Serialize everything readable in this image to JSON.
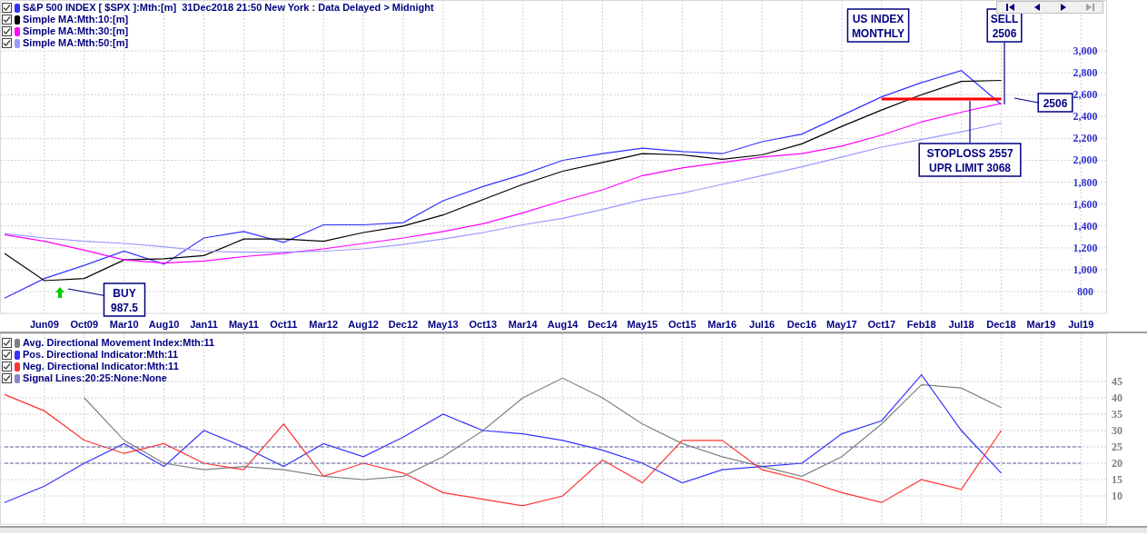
{
  "price_panel": {
    "legend": [
      {
        "label": "S&P 500 INDEX [ $SPX ]:Mth:[m]  31Dec2018 21:50 New York : Data Delayed > Midnight",
        "color": "#3333ff",
        "checked": true
      },
      {
        "label": "Simple MA:Mth:10:[m]",
        "color": "#000000",
        "checked": true
      },
      {
        "label": "Simple MA:Mth:30:[m]",
        "color": "#ff00ff",
        "checked": true
      },
      {
        "label": "Simple MA:Mth:50:[m]",
        "color": "#9999ff",
        "checked": true
      }
    ],
    "nav_buttons": [
      {
        "kind": "first",
        "disabled": false
      },
      {
        "kind": "prev",
        "disabled": false
      },
      {
        "kind": "next",
        "disabled": false
      },
      {
        "kind": "last",
        "disabled": true
      }
    ],
    "callouts": [
      {
        "lines": [
          "BUY",
          "987.5"
        ]
      },
      {
        "lines": [
          "US INDEX",
          "MONTHLY"
        ]
      },
      {
        "lines": [
          "SELL",
          "2506"
        ]
      },
      {
        "lines": [
          "2506"
        ]
      },
      {
        "lines": [
          "STOPLOSS 2557",
          "UPR LIMIT 3068"
        ]
      }
    ],
    "chart_data": {
      "type": "line",
      "categories": [
        null,
        "Jun09",
        "Oct09",
        "Mar10",
        "Aug10",
        "Jan11",
        "May11",
        "Oct11",
        "Mar12",
        "Aug12",
        "Dec12",
        "May13",
        "Oct13",
        "Mar14",
        "Aug14",
        "Dec14",
        "May15",
        "Oct15",
        "Mar16",
        "Jul16",
        "Dec16",
        "May17",
        "Oct17",
        "Feb18",
        "Jul18",
        "Dec18",
        "Mar19",
        "Jul19"
      ],
      "ylim": [
        601,
        3465
      ],
      "yticks": [
        {
          "value": 800,
          "label": "800"
        },
        {
          "value": 1000,
          "label": "1,000"
        },
        {
          "value": 1200,
          "label": "1,200"
        },
        {
          "value": 1400,
          "label": "1,400"
        },
        {
          "value": 1600,
          "label": "1,600"
        },
        {
          "value": 1800,
          "label": "1,800"
        },
        {
          "value": 2000,
          "label": "2,000"
        },
        {
          "value": 2200,
          "label": "2,200"
        },
        {
          "value": 2400,
          "label": "2,400"
        },
        {
          "value": 2600,
          "label": "2,600"
        },
        {
          "value": 2800,
          "label": "2,800"
        },
        {
          "value": 3000,
          "label": "3,000"
        }
      ],
      "series": [
        {
          "color": "#3333ff",
          "values": [
            740,
            920,
            1040,
            1170,
            1050,
            1290,
            1350,
            1250,
            1410,
            1410,
            1430,
            1630,
            1760,
            1870,
            2000,
            2060,
            2110,
            2080,
            2060,
            2170,
            2240,
            2410,
            2580,
            2710,
            2820,
            2510,
            null,
            null
          ]
        },
        {
          "color": "#000000",
          "values": [
            1150,
            900,
            920,
            1090,
            1100,
            1130,
            1280,
            1280,
            1260,
            1340,
            1400,
            1500,
            1640,
            1780,
            1900,
            1980,
            2060,
            2050,
            2010,
            2050,
            2150,
            2310,
            2460,
            2600,
            2720,
            2730,
            null,
            null
          ]
        },
        {
          "color": "#ff00ff",
          "values": [
            1320,
            1260,
            1180,
            1090,
            1060,
            1080,
            1120,
            1150,
            1190,
            1240,
            1290,
            1350,
            1420,
            1520,
            1630,
            1730,
            1860,
            1930,
            1980,
            2030,
            2060,
            2130,
            2230,
            2350,
            2440,
            2520,
            null,
            null
          ]
        },
        {
          "color": "#9999ff",
          "values": [
            1330,
            1290,
            1260,
            1240,
            1210,
            1170,
            1160,
            1160,
            1170,
            1190,
            1230,
            1280,
            1340,
            1410,
            1470,
            1550,
            1640,
            1700,
            1780,
            1860,
            1940,
            2030,
            2120,
            2190,
            2260,
            2340,
            null,
            null
          ]
        },
        {
          "color": "#ff0000",
          "values": [
            null,
            null,
            null,
            null,
            null,
            null,
            null,
            null,
            null,
            null,
            null,
            null,
            null,
            null,
            null,
            null,
            null,
            null,
            null,
            null,
            null,
            null,
            2560,
            2560,
            2560,
            2560,
            null,
            null
          ]
        }
      ],
      "grid": true
    }
  },
  "indicator_panel": {
    "legend": [
      {
        "label": "Avg. Directional Movement Index:Mth:11",
        "color": "#808080",
        "checked": true
      },
      {
        "label": "Pos. Directional Indicator:Mth:11",
        "color": "#3333ff",
        "checked": true
      },
      {
        "label": "Neg. Directional Indicator:Mth:11",
        "color": "#ff3333",
        "checked": true
      },
      {
        "label": "Signal Lines:20:25:None:None",
        "color": "#8888cc",
        "checked": true
      }
    ],
    "chart_data": {
      "type": "line",
      "categories": [
        null,
        null,
        null,
        null,
        null,
        null,
        null,
        null,
        null,
        null,
        null,
        null,
        null,
        null,
        null,
        null,
        null,
        null,
        null,
        null,
        null,
        null,
        null,
        null,
        null,
        null,
        null,
        null
      ],
      "ylim": [
        1.4,
        59.7
      ],
      "yticks": [
        10,
        15,
        20,
        25,
        30,
        35,
        40,
        45
      ],
      "series": [
        {
          "color": "#808080",
          "values": [
            null,
            null,
            40,
            27,
            20,
            18,
            19,
            18,
            16,
            15,
            16,
            22,
            30,
            40,
            46,
            40,
            32,
            26,
            22,
            19,
            16,
            22,
            32,
            44,
            43,
            37,
            null,
            null
          ]
        },
        {
          "color": "#3333ff",
          "values": [
            8,
            13,
            20,
            26,
            19,
            30,
            25,
            19,
            26,
            22,
            28,
            35,
            30,
            29,
            27,
            24,
            20,
            14,
            18,
            19,
            20,
            29,
            33,
            47,
            30,
            17,
            null,
            null
          ]
        },
        {
          "color": "#ff3333",
          "values": [
            41,
            36,
            27,
            23,
            26,
            20,
            18,
            32,
            16,
            20,
            17,
            11,
            9,
            7,
            10,
            21,
            14,
            27,
            27,
            18,
            15,
            11,
            8,
            15,
            12,
            30,
            null,
            null
          ]
        },
        {
          "color": "#6666aa",
          "line_style": "dashed",
          "values": [
            20,
            20,
            20,
            20,
            20,
            20,
            20,
            20,
            20,
            20,
            20,
            20,
            20,
            20,
            20,
            20,
            20,
            20,
            20,
            20,
            20,
            20,
            20,
            20,
            20,
            20,
            20,
            20
          ]
        },
        {
          "color": "#6666aa",
          "line_style": "dashed",
          "values": [
            25,
            25,
            25,
            25,
            25,
            25,
            25,
            25,
            25,
            25,
            25,
            25,
            25,
            25,
            25,
            25,
            25,
            25,
            25,
            25,
            25,
            25,
            25,
            25,
            25,
            25,
            25,
            25
          ]
        }
      ],
      "grid": true
    }
  }
}
